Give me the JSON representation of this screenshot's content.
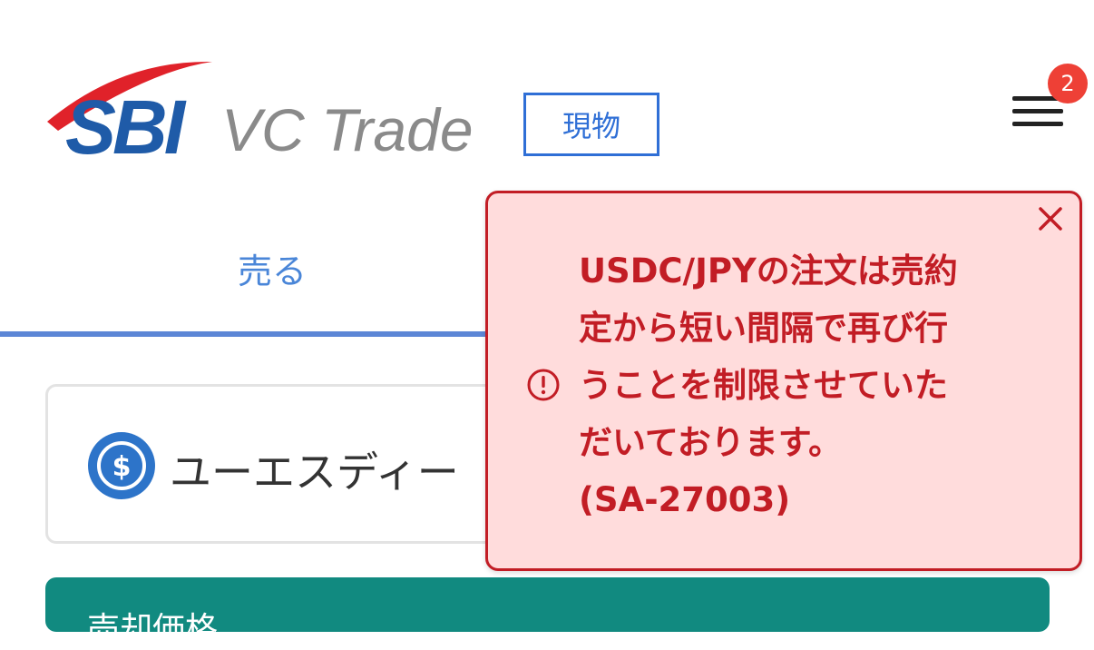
{
  "header": {
    "logo_main": "SBI",
    "logo_sub": "VC Trade",
    "mode_label": "現物",
    "notification_count": "2"
  },
  "tabs": {
    "sell_label": "売る"
  },
  "currency": {
    "name": "ユーエスディー"
  },
  "price_panel": {
    "label": "売却価格"
  },
  "alert": {
    "message_lines": [
      "USDC/JPYの注文は売約",
      "定から短い間隔で再び行",
      "うことを制限させていた",
      "だいております。",
      "(SA-27003)"
    ]
  },
  "colors": {
    "brand_blue": "#1f5ba8",
    "brand_red": "#e0222a",
    "accent_blue": "#2f6fd6",
    "error_red": "#c21d25",
    "error_bg": "#ffdcdc",
    "teal": "#118a80",
    "badge_red": "#ee4036"
  },
  "icons": {
    "menu": "hamburger-menu-icon",
    "close": "close-icon",
    "alert": "exclamation-circle-icon",
    "currency": "dollar-coin-icon"
  }
}
